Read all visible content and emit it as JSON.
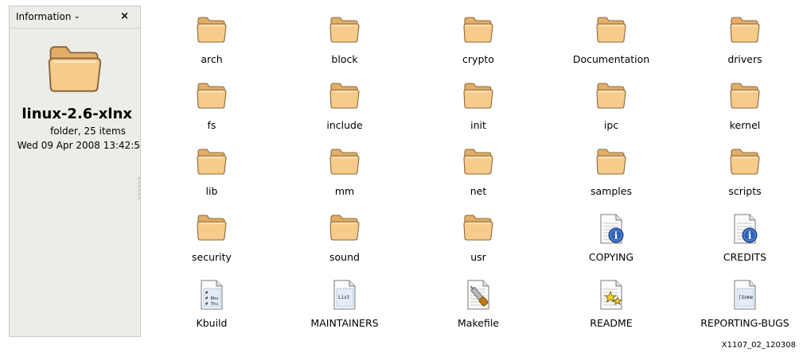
{
  "sidebar": {
    "selector_label": "Information",
    "close_label": "×",
    "folder_name": "linux-2.6-xlnx",
    "folder_meta": "folder, 25 items",
    "folder_date": "Wed 09 Apr 2008 13:42:5"
  },
  "items": [
    {
      "label": "arch",
      "icon": "folder"
    },
    {
      "label": "block",
      "icon": "folder"
    },
    {
      "label": "crypto",
      "icon": "folder"
    },
    {
      "label": "Documentation",
      "icon": "folder"
    },
    {
      "label": "drivers",
      "icon": "folder"
    },
    {
      "label": "fs",
      "icon": "folder"
    },
    {
      "label": "include",
      "icon": "folder"
    },
    {
      "label": "init",
      "icon": "folder"
    },
    {
      "label": "ipc",
      "icon": "folder"
    },
    {
      "label": "kernel",
      "icon": "folder"
    },
    {
      "label": "lib",
      "icon": "folder"
    },
    {
      "label": "mm",
      "icon": "folder"
    },
    {
      "label": "net",
      "icon": "folder"
    },
    {
      "label": "samples",
      "icon": "folder"
    },
    {
      "label": "scripts",
      "icon": "folder"
    },
    {
      "label": "security",
      "icon": "folder"
    },
    {
      "label": "sound",
      "icon": "folder"
    },
    {
      "label": "usr",
      "icon": "folder"
    },
    {
      "label": "COPYING",
      "icon": "info-document"
    },
    {
      "label": "CREDITS",
      "icon": "info-document"
    },
    {
      "label": "Kbuild",
      "icon": "text-document",
      "preview": [
        "#",
        "# Kbu",
        "# Thi"
      ]
    },
    {
      "label": "MAINTAINERS",
      "icon": "text-document",
      "preview": [
        "List"
      ]
    },
    {
      "label": "Makefile",
      "icon": "makefile-document"
    },
    {
      "label": "README",
      "icon": "readme-document"
    },
    {
      "label": "REPORTING-BUGS",
      "icon": "text-document",
      "preview": [
        "[Some"
      ]
    }
  ],
  "caption": "X1107_02_120308",
  "colors": {
    "folder_fill": "#f7cb8a",
    "folder_stroke": "#8a6a3e",
    "sidebar_bg": "#ecece9",
    "info_blue": "#2d62b8"
  }
}
